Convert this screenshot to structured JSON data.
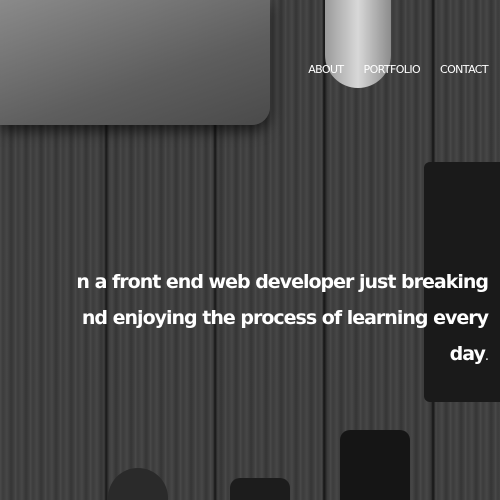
{
  "nav": {
    "items": [
      {
        "label": "ABOUT"
      },
      {
        "label": "PORTFOLIO"
      },
      {
        "label": "CONTACT"
      }
    ]
  },
  "hero": {
    "lines": [
      "n a front end web developer just breaking",
      "nd enjoying the process of learning every",
      "day"
    ],
    "period": "."
  },
  "colors": {
    "text": "#ffffff",
    "background": "#404040"
  }
}
